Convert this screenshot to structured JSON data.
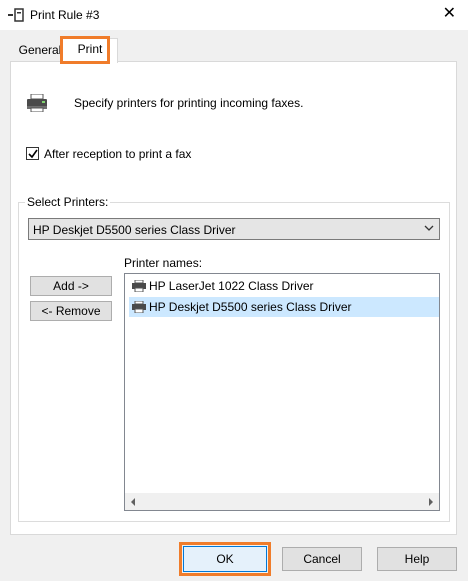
{
  "window": {
    "title": "Print Rule #3",
    "icon": "fax-rule-icon",
    "close_glyph": "✕"
  },
  "tabs": [
    {
      "label": "General",
      "active": false
    },
    {
      "label": "Print",
      "active": true
    }
  ],
  "print_tab": {
    "description": "Specify printers for printing incoming faxes.",
    "after_reception_checkbox": {
      "label": "After reception to print a fax",
      "checked": true
    },
    "select_printers_group": {
      "label": "Select Printers:",
      "combo_value": "HP Deskjet D5500 series Class Driver",
      "add_button": "Add ->",
      "remove_button": "<- Remove",
      "names_label": "Printer names:",
      "printer_names": [
        {
          "name": "HP LaserJet 1022 Class Driver",
          "selected": false
        },
        {
          "name": "HP Deskjet D5500 series Class Driver",
          "selected": true
        }
      ]
    }
  },
  "footer": {
    "ok": "OK",
    "cancel": "Cancel",
    "help": "Help"
  },
  "highlight_color": "#f07c2a"
}
